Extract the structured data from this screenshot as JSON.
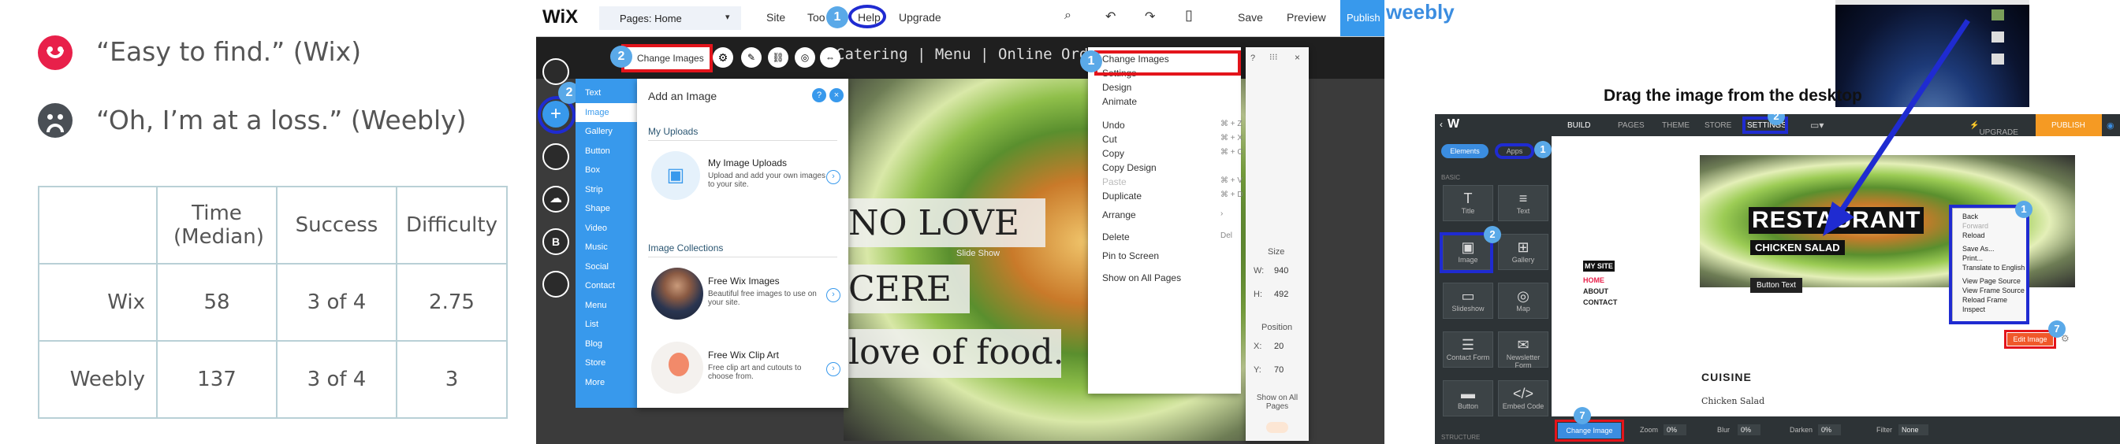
{
  "left": {
    "quotes": [
      {
        "text": "“Easy to find.” (Wix)",
        "face": "happy-face-icon",
        "color": "#e8204a"
      },
      {
        "text": "“Oh, I’m at a loss.” (Weebly)",
        "face": "sad-face-icon",
        "color": "#4a4f55"
      }
    ],
    "table": {
      "headers": [
        "",
        "Time (Median)",
        "Success",
        "Difficulty"
      ],
      "rows": [
        [
          "Wix",
          "58",
          "3 of 4",
          "2.75"
        ],
        [
          "Weebly",
          "137",
          "3 of 4",
          "3"
        ]
      ]
    }
  },
  "wix": {
    "logo": "WiX",
    "pages_dropdown": "Pages: Home",
    "menu": [
      "Site",
      "Too",
      "Help",
      "Upgrade"
    ],
    "actions": [
      "Save",
      "Preview",
      "Publish"
    ],
    "site_nav": [
      "Catering",
      "Menu",
      "Online Ordering"
    ],
    "change_images_button": "Change Images",
    "slide_show_label": "Slide Show",
    "hero_lines": [
      "NO LOVE",
      "CERE",
      "love of food."
    ],
    "sidebar_items": [
      "Text",
      "Image",
      "Gallery",
      "Button",
      "Box",
      "Strip",
      "Shape",
      "Video",
      "Music",
      "Social",
      "Contact",
      "Menu",
      "List",
      "Blog",
      "Store",
      "More"
    ],
    "add_image": {
      "title": "Add an Image",
      "uploads_heading": "My Uploads",
      "upload_title": "My Image Uploads",
      "upload_desc": "Upload and add your own images to your site.",
      "collections_heading": "Image Collections",
      "free_images_title": "Free Wix Images",
      "free_images_desc": "Beautiful free images to use on your site.",
      "clip_art_title": "Free Wix Clip Art",
      "clip_art_desc": "Free clip art and cutouts to choose from."
    },
    "context_menu": [
      {
        "label": "Change Images",
        "key": ""
      },
      {
        "label": "Settings",
        "key": ""
      },
      {
        "label": "Design",
        "key": ""
      },
      {
        "label": "Animate",
        "key": ""
      },
      {
        "label": "Undo",
        "key": "⌘ + Z"
      },
      {
        "label": "Cut",
        "key": "⌘ + X"
      },
      {
        "label": "Copy",
        "key": "⌘ + C"
      },
      {
        "label": "Copy Design",
        "key": ""
      },
      {
        "label": "Paste",
        "key": "⌘ + V"
      },
      {
        "label": "Duplicate",
        "key": "⌘ + D"
      },
      {
        "label": "Arrange",
        "key": "›"
      },
      {
        "label": "Delete",
        "key": "Del"
      },
      {
        "label": "Pin to Screen",
        "key": ""
      },
      {
        "label": "Show on All Pages",
        "key": ""
      }
    ],
    "size": {
      "label": "Size",
      "w_label": "W:",
      "w": "940",
      "h_label": "H:",
      "h": "492"
    },
    "position": {
      "label": "Position",
      "x_label": "X:",
      "x": "20",
      "y_label": "Y:",
      "y": "70"
    },
    "show_all_pages": "Show on All Pages",
    "badges": [
      "1",
      "2",
      "2",
      "1"
    ]
  },
  "weebly": {
    "logo": "weebly",
    "drag_caption": "Drag the image from the desktop",
    "top_tabs": [
      "BUILD",
      "PAGES",
      "THEME",
      "STORE",
      "SETTINGS"
    ],
    "upgrade": "UPGRADE",
    "publish": "PUBLISH",
    "side_tabs": [
      "Elements",
      "Apps"
    ],
    "basic_label": "BASIC",
    "structure_label": "STRUCTURE",
    "tiles": [
      "Title",
      "Text",
      "Image",
      "Gallery",
      "Slideshow",
      "Map",
      "Contact Form",
      "Newsletter Form",
      "Button",
      "Embed Code"
    ],
    "site_nav": [
      "MY SITE",
      "HOME",
      "ABOUT",
      "CONTACT"
    ],
    "hero_title": "RESTAURANT",
    "hero_sub": "CHICKEN SALAD",
    "button_text": "Button Text",
    "edit_image": "Edit Image",
    "cuisine": "CUISINE",
    "chicken_salad": "Chicken Salad",
    "context_menu": [
      "Back",
      "Forward",
      "Reload",
      "Save As...",
      "Print...",
      "Translate to English",
      "View Page Source",
      "View Frame Source",
      "Reload Frame",
      "Inspect"
    ],
    "bottom": {
      "change_image": "Change Image",
      "zoom": "Zoom",
      "zoom_val": "0%",
      "blur": "Blur",
      "blur_val": "0%",
      "darken": "Darken",
      "darken_val": "0%",
      "filter": "Filter",
      "filter_val": "None"
    },
    "badges": [
      "1",
      "2",
      "2",
      "1",
      "7",
      "7"
    ]
  }
}
